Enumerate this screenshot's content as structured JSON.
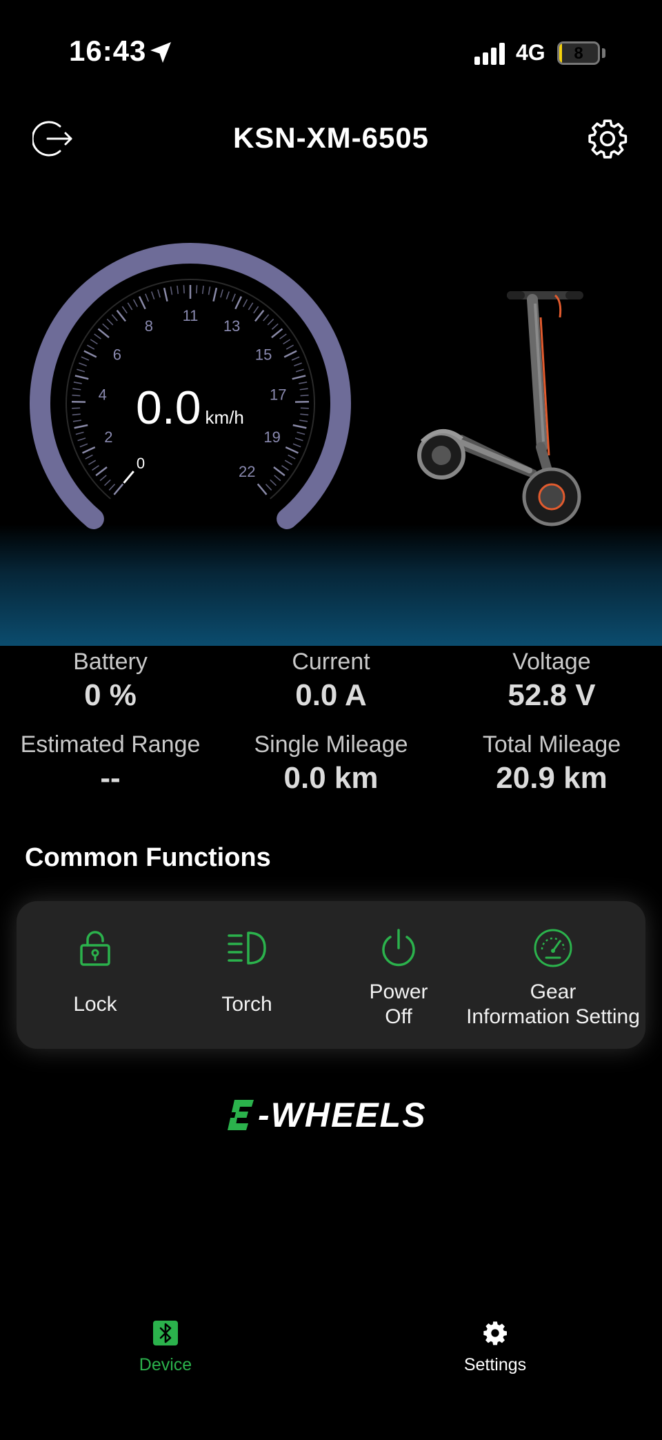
{
  "status_bar": {
    "time": "16:43",
    "network": "4G",
    "battery_level": "8",
    "battery_fraction": 0.08
  },
  "header": {
    "title": "KSN-XM-6505",
    "exit_icon": "exit-icon",
    "settings_icon": "gear-icon"
  },
  "gauge": {
    "speed": "0.0",
    "unit": "km/h",
    "ticks": [
      "0",
      "2",
      "4",
      "6",
      "8",
      "11",
      "13",
      "15",
      "17",
      "19",
      "22"
    ],
    "arc_color": "#6e6c98"
  },
  "stats": {
    "battery": {
      "label": "Battery",
      "value": "0 %"
    },
    "current": {
      "label": "Current",
      "value": "0.0 A"
    },
    "voltage": {
      "label": "Voltage",
      "value": "52.8 V"
    },
    "range": {
      "label": "Estimated Range",
      "value": "--"
    },
    "single_mileage": {
      "label": "Single Mileage",
      "value": "0.0 km"
    },
    "total_mileage": {
      "label": "Total Mileage",
      "value": "20.9 km"
    }
  },
  "common_functions": {
    "title": "Common Functions",
    "accent": "#2bb24c",
    "lock": "Lock",
    "torch": "Torch",
    "power_line1": "Power",
    "power_line2": "Off",
    "gear_line1": "Gear",
    "gear_line2": "Information Setting"
  },
  "logo": {
    "text": "-WHEELS"
  },
  "tabs": {
    "device": "Device",
    "settings": "Settings"
  }
}
